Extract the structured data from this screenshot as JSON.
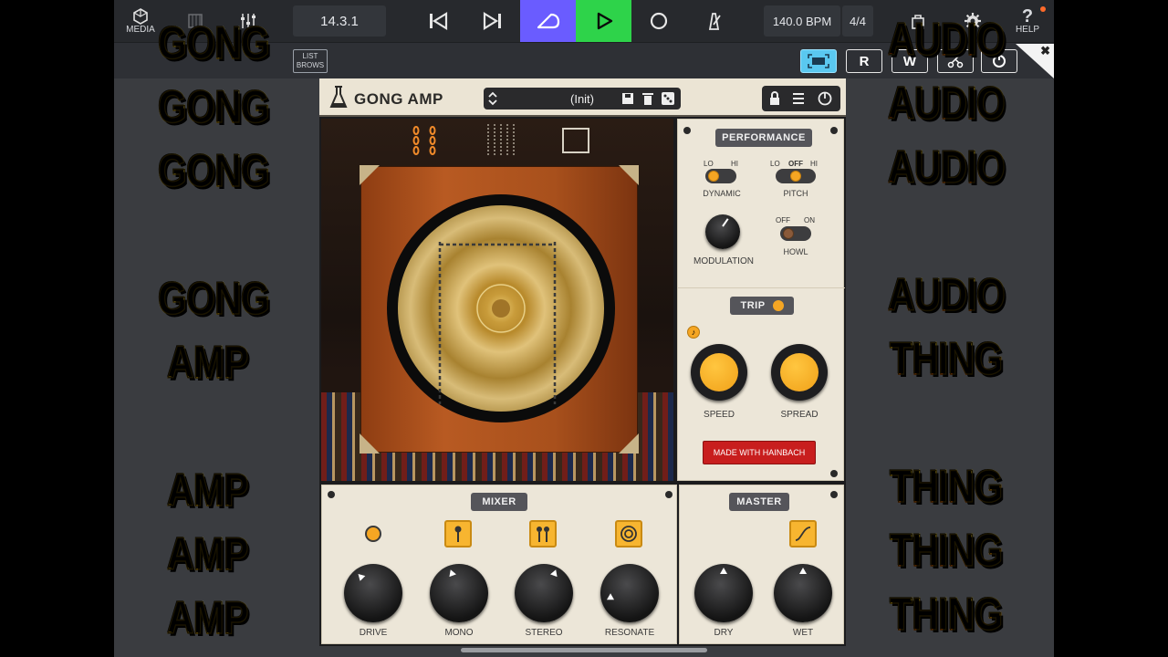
{
  "transport": {
    "media_label": "MEDIA",
    "position": "14.3.1",
    "tempo": "140.0 BPM",
    "time_signature": "4/4",
    "help_label": "HELP"
  },
  "toolbar": {
    "list_browser_label_1": "LIST",
    "list_browser_label_2": "BROWS",
    "r_label": "R",
    "w_label": "W"
  },
  "overlay": {
    "left": [
      "GONG",
      "GONG",
      "GONG",
      "GONG",
      "AMP",
      "AMP",
      "AMP",
      "AMP"
    ],
    "right": [
      "AUDIO",
      "AUDIO",
      "AUDIO",
      "AUDIO",
      "THING",
      "THING",
      "THING",
      "THING"
    ]
  },
  "plugin": {
    "title": "GONG AMP",
    "preset": "(Init)",
    "performance": {
      "label": "PERFORMANCE",
      "dynamic": {
        "label": "DYNAMIC",
        "lo": "LO",
        "hi": "HI"
      },
      "pitch": {
        "label": "PITCH",
        "lo": "LO",
        "off": "OFF",
        "hi": "HI"
      },
      "modulation": {
        "label": "MODULATION"
      },
      "howl": {
        "label": "HOWL",
        "off": "OFF",
        "on": "ON"
      }
    },
    "trip": {
      "label": "TRIP",
      "speed": "SPEED",
      "spread": "SPREAD",
      "credit": "MADE WITH HAINBACH"
    },
    "mixer": {
      "label": "MIXER",
      "channels": [
        "DRIVE",
        "MONO",
        "STEREO",
        "RESONATE"
      ]
    },
    "master": {
      "label": "MASTER",
      "channels": [
        "DRY",
        "WET"
      ]
    }
  },
  "colors": {
    "accent": "#f7b530",
    "record_active": "#6a5cff",
    "play_active": "#2ed34a",
    "credit_red": "#c81e1e",
    "panel": "#ece6d8"
  }
}
